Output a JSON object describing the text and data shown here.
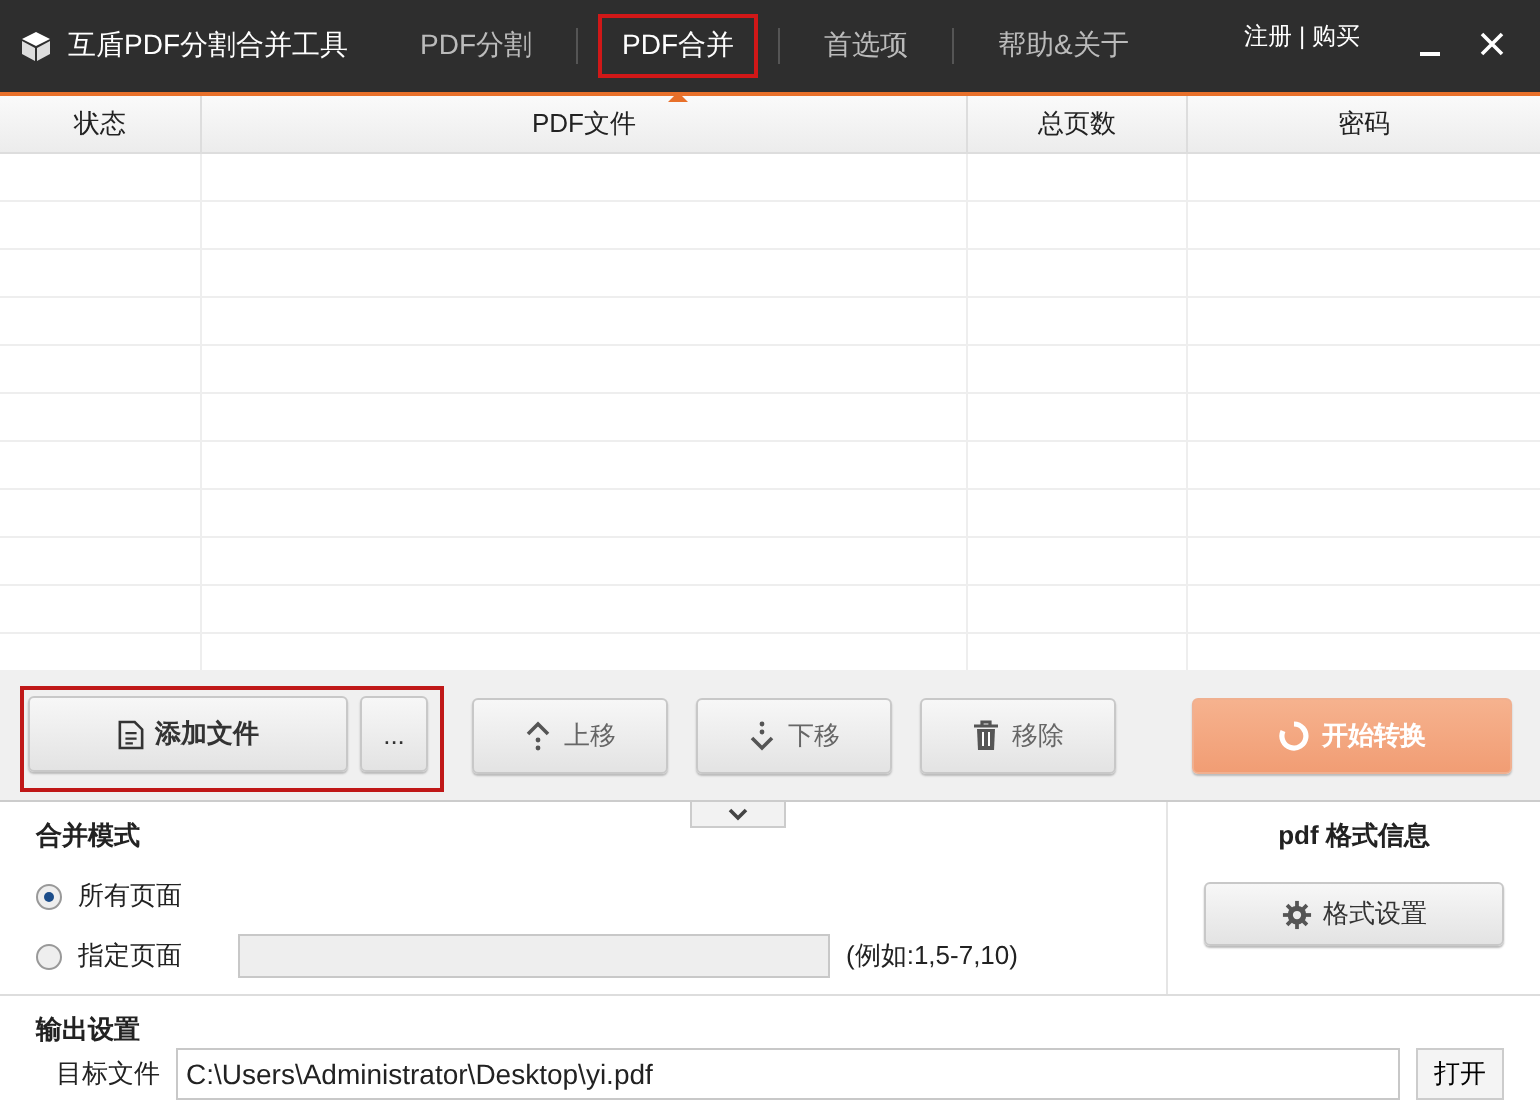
{
  "window": {
    "title": "互盾PDF分割合并工具",
    "account": "注册 | 购买"
  },
  "tabs": [
    {
      "label": "PDF分割",
      "selected": false,
      "highlighted": false
    },
    {
      "label": "PDF合并",
      "selected": true,
      "highlighted": true
    },
    {
      "label": "首选项",
      "selected": false,
      "highlighted": false
    },
    {
      "label": "帮助&关于",
      "selected": false,
      "highlighted": false
    }
  ],
  "table": {
    "columns": [
      "状态",
      "PDF文件",
      "总页数",
      "密码"
    ]
  },
  "toolbar": {
    "add_file": "添加文件",
    "more": "...",
    "add_group_highlighted": true,
    "move_up": "上移",
    "move_down": "下移",
    "remove": "移除",
    "start": "开始转换",
    "start_disabled": true
  },
  "merge_mode": {
    "title": "合并模式",
    "options": [
      {
        "label": "所有页面",
        "selected": true
      },
      {
        "label": "指定页面",
        "selected": false
      }
    ],
    "example": "(例如:1,5-7,10)"
  },
  "format_info": {
    "title": "pdf 格式信息",
    "button": "格式设置"
  },
  "output": {
    "title": "输出设置",
    "target_label": "目标文件",
    "path": "C:\\Users\\Administrator\\Desktop\\yi.pdf",
    "open_button": "打开"
  }
}
